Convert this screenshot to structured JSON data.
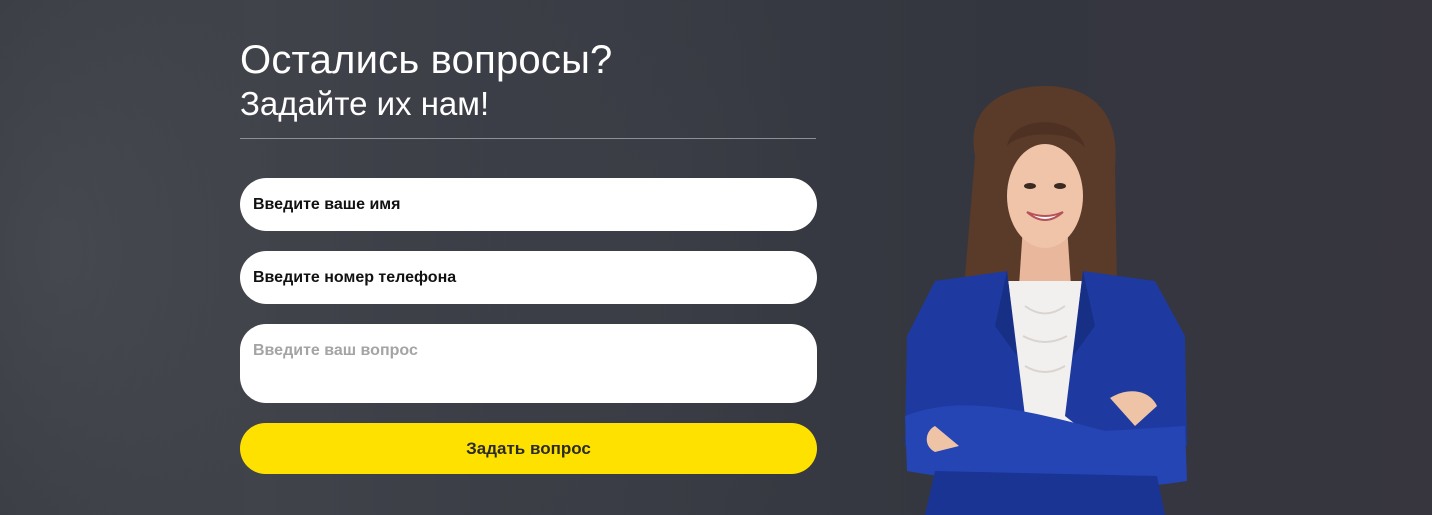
{
  "heading": {
    "title": "Остались вопросы?",
    "subtitle": "Задайте их нам!"
  },
  "form": {
    "name_placeholder": "Введите ваше имя",
    "phone_placeholder": "Введите номер телефона",
    "question_placeholder": "Введите ваш вопрос",
    "submit_label": "Задать вопрос"
  },
  "colors": {
    "background": "#393b44",
    "accent": "#ffe100",
    "field": "#ffffff",
    "blazer": "#1e3aa0"
  },
  "illustration": {
    "subject": "consultant-photo"
  }
}
